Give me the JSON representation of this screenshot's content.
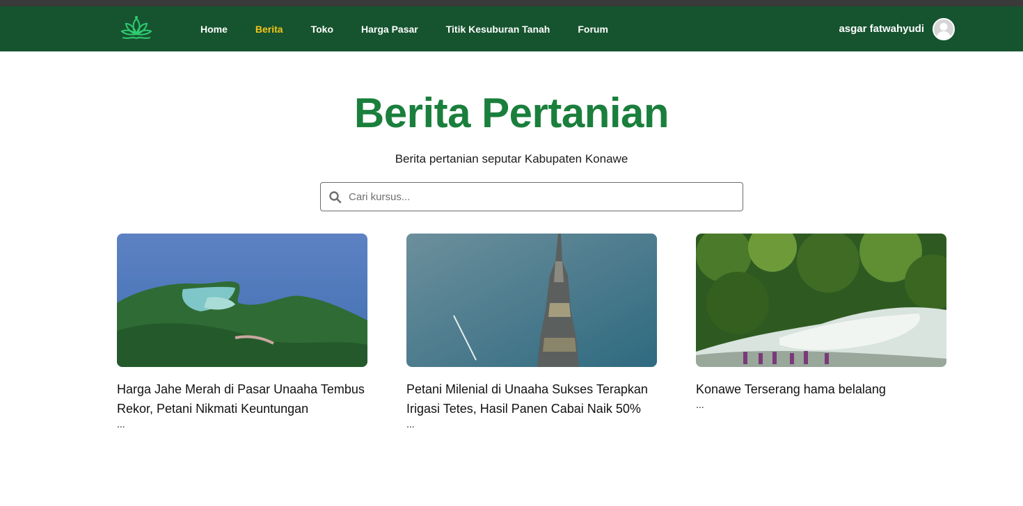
{
  "nav": {
    "links": [
      {
        "label": "Home",
        "active": false
      },
      {
        "label": "Berita",
        "active": true
      },
      {
        "label": "Toko",
        "active": false
      },
      {
        "label": "Harga Pasar",
        "active": false
      },
      {
        "label": "Titik Kesuburan Tanah",
        "active": false
      },
      {
        "label": "Forum",
        "active": false
      }
    ],
    "user_name": "asgar fatwahyudi"
  },
  "hero": {
    "title": "Berita Pertanian",
    "subtitle": "Berita pertanian seputar Kabupaten Konawe"
  },
  "search": {
    "placeholder": "Cari kursus..."
  },
  "articles": [
    {
      "title": "Harga Jahe Merah di Pasar Unaaha Tembus Rekor, Petani Nikmati Keuntungan",
      "excerpt": "..."
    },
    {
      "title": "Petani Milenial di Unaaha Sukses Terapkan Irigasi Tetes, Hasil Panen Cabai Naik 50%",
      "excerpt": "..."
    },
    {
      "title": "Konawe Terserang hama belalang",
      "excerpt": "..."
    }
  ],
  "colors": {
    "navbar": "#16532f",
    "active_link": "#f5c518",
    "title": "#1a7f3c"
  }
}
